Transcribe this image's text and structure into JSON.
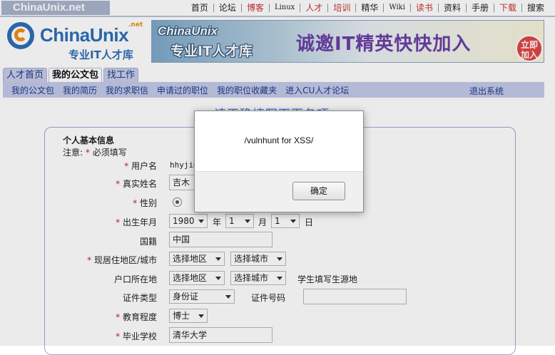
{
  "top_nav": {
    "site_name": "ChinaUnix.net",
    "items": [
      {
        "label": "首页"
      },
      {
        "label": "论坛"
      },
      {
        "label": "博客"
      },
      {
        "label": "Linux"
      },
      {
        "label": "人才"
      },
      {
        "label": "培训"
      },
      {
        "label": "精华"
      },
      {
        "label": "Wiki"
      },
      {
        "label": "读书"
      },
      {
        "label": "资料"
      },
      {
        "label": "手册"
      },
      {
        "label": "下载"
      },
      {
        "label": "搜索"
      }
    ]
  },
  "header": {
    "logo_text": "ChinaUnix",
    "logo_net": ".net",
    "logo_subtitle": "专业IT人才库",
    "banner_line1": "ChinaUnix",
    "banner_line2": "专业IT人才库",
    "banner_slogan": "诚邀IT精英快快加入",
    "banner_join": "立即加入"
  },
  "tabs": [
    {
      "label": "人才首页"
    },
    {
      "label": "我的公文包"
    },
    {
      "label": "找工作"
    }
  ],
  "subnav": {
    "items": [
      {
        "label": "我的公文包"
      },
      {
        "label": "我的简历"
      },
      {
        "label": "我的求职信"
      },
      {
        "label": "申请过的职位"
      },
      {
        "label": "我的职位收藏夹"
      },
      {
        "label": "进入CU人才论坛"
      }
    ],
    "logout": "退出系统"
  },
  "page_heading": "请正确填写下面各项",
  "form": {
    "section_title": "个人基本信息",
    "note_prefix": "注意:",
    "note_suffix": "必须填写",
    "username_label": "用户名",
    "username_value": "hhyjim",
    "realname_label": "真实姓名",
    "realname_value": "吉木",
    "gender_label": "性别",
    "birth_label": "出生年月",
    "birth_year": "1980",
    "year_unit": "年",
    "birth_month": "1",
    "month_unit": "月",
    "birth_day": "1",
    "day_unit": "日",
    "nationality_label": "国籍",
    "nationality_value": "中国",
    "residence_label": "现居住地区/城市",
    "residence_region": "选择地区",
    "residence_city": "选择城市",
    "hukou_label": "户口所在地",
    "hukou_region": "选择地区",
    "hukou_city": "选择城市",
    "hukou_hint": "学生填写生源地",
    "id_type_label": "证件类型",
    "id_type_value": "身份证",
    "id_number_label": "证件号码",
    "id_number_value": "",
    "education_label": "教育程度",
    "education_value": "博士",
    "school_label": "毕业学校",
    "school_value": "清华大学"
  },
  "dialog": {
    "message": "/vulnhunt for XSS/",
    "ok_label": "确定"
  },
  "colors": {
    "nav_highlight": "#c83232",
    "link_blue": "#1d3b8a",
    "subnav_bg": "#c4c9e8",
    "required_star": "#cc2222"
  }
}
